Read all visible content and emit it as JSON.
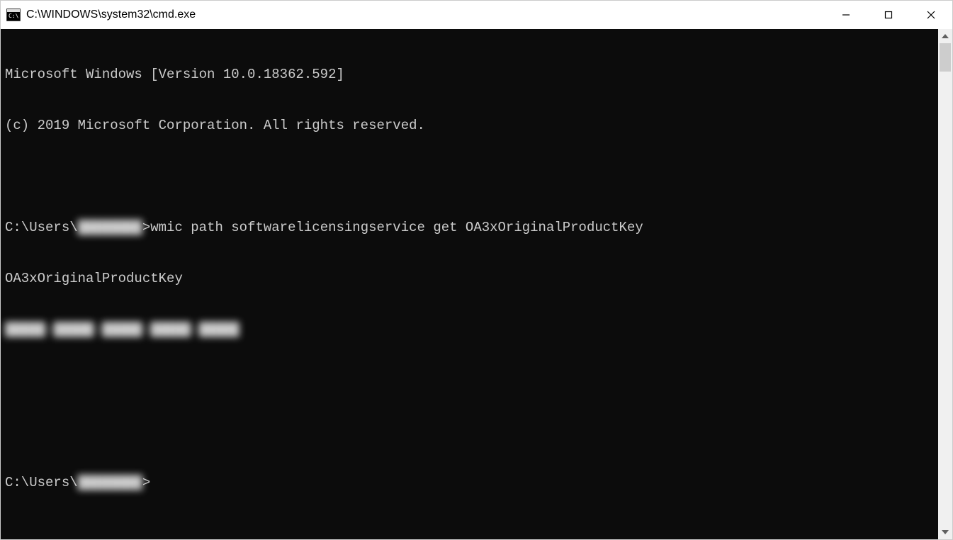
{
  "titlebar": {
    "title": "C:\\WINDOWS\\system32\\cmd.exe"
  },
  "terminal": {
    "line1": "Microsoft Windows [Version 10.0.18362.592]",
    "line2": "(c) 2019 Microsoft Corporation. All rights reserved.",
    "prompt1_prefix": "C:\\Users\\",
    "prompt1_user_redacted": "████████",
    "prompt1_suffix": ">",
    "command1": "wmic path softwarelicensingservice get OA3xOriginalProductKey",
    "output_header": "OA3xOriginalProductKey",
    "output_key_redacted": "█████-█████-█████-█████-█████",
    "prompt2_prefix": "C:\\Users\\",
    "prompt2_user_redacted": "████████",
    "prompt2_suffix": ">"
  }
}
